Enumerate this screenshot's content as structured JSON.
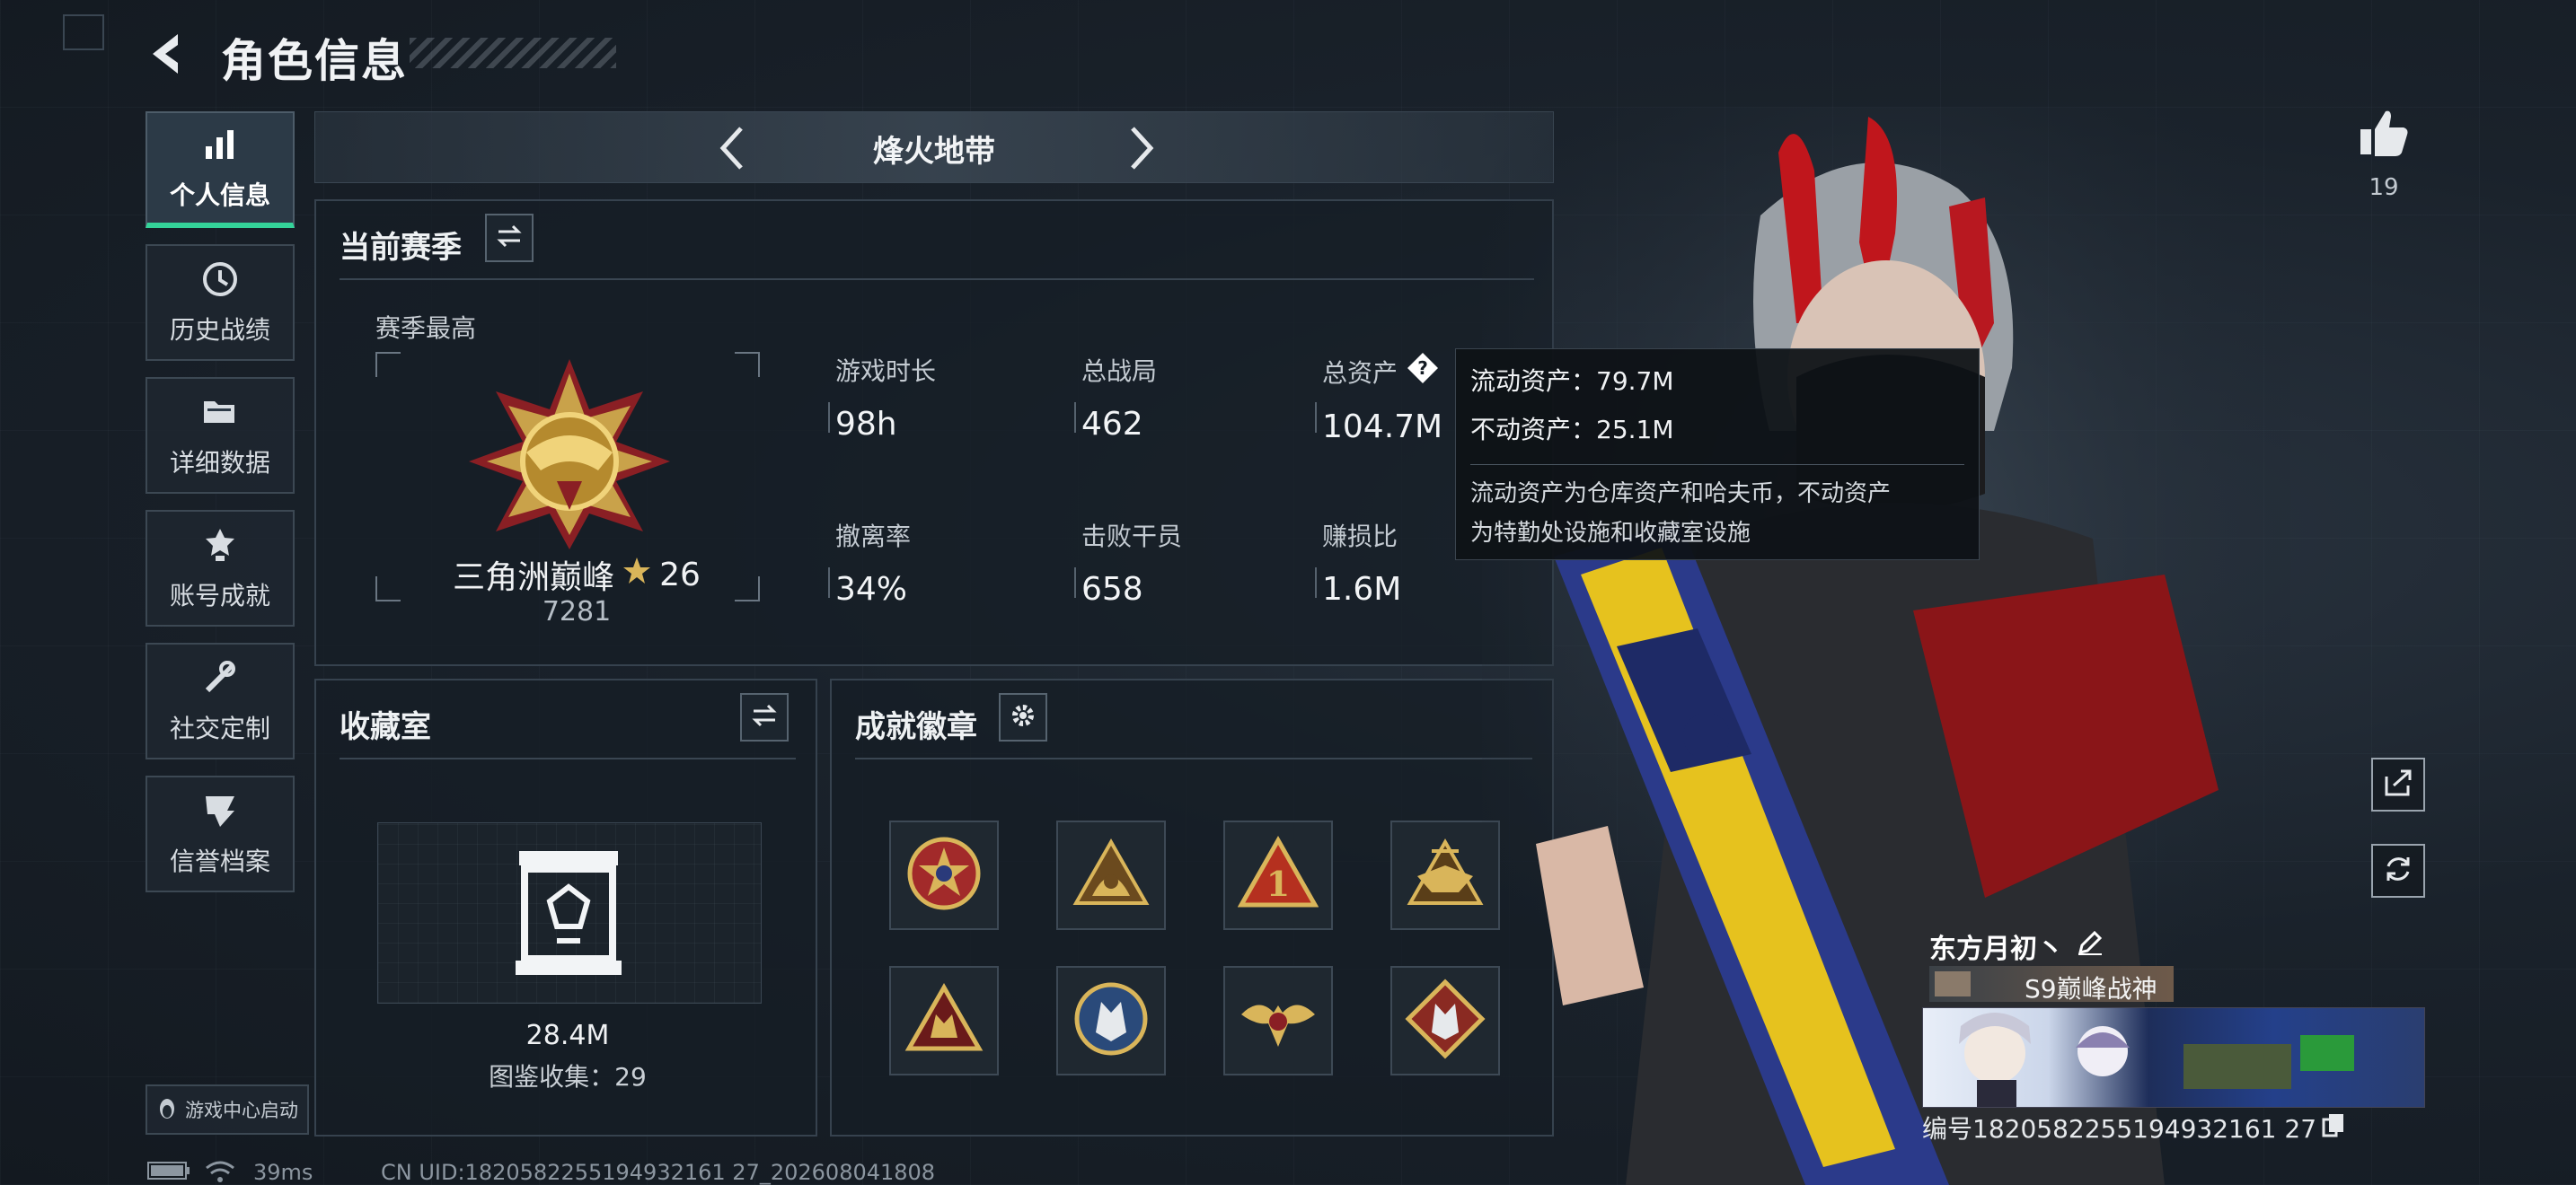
{
  "header": {
    "title": "角色信息"
  },
  "sidebar": {
    "items": [
      {
        "label": "个人信息",
        "icon": "bar-chart-icon",
        "active": true
      },
      {
        "label": "历史战绩",
        "icon": "history-icon",
        "active": false
      },
      {
        "label": "详细数据",
        "icon": "folder-icon",
        "active": false
      },
      {
        "label": "账号成就",
        "icon": "achievement-icon",
        "active": false
      },
      {
        "label": "社交定制",
        "icon": "tools-icon",
        "active": false
      },
      {
        "label": "信誉档案",
        "icon": "credit-icon",
        "active": false
      }
    ],
    "game_center_label": "游戏中心启动"
  },
  "mode_bar": {
    "title": "烽火地带"
  },
  "season": {
    "title": "当前赛季",
    "best_label": "赛季最高",
    "rank_name": "三角洲巅峰",
    "rank_stars": "26",
    "rank_score": "7281",
    "stats": [
      {
        "label": "游戏时长",
        "value": "98h"
      },
      {
        "label": "总战局",
        "value": "462"
      },
      {
        "label": "总资产",
        "value": "104.7M"
      },
      {
        "label": "撤离率",
        "value": "34%"
      },
      {
        "label": "击败干员",
        "value": "658"
      },
      {
        "label": "赚损比",
        "value": "1.6M"
      }
    ]
  },
  "tooltip": {
    "liquid": "流动资产：79.7M",
    "fixed": "不动资产：25.1M",
    "desc_line1": "流动资产为仓库资产和哈夫币，不动资产",
    "desc_line2": "为特勤处设施和收藏室设施"
  },
  "collection": {
    "title": "收藏室",
    "value": "28.4M",
    "codex": "图鉴收集：29"
  },
  "badges": {
    "title": "成就徽章",
    "items": [
      "star-medal-icon",
      "beast-badge-icon",
      "number-one-badge-icon",
      "eagle-triangle-badge-icon",
      "wolf-triangle-badge-icon",
      "wolf-circle-badge-icon",
      "winged-badge-icon",
      "wolf-diamond-badge-icon"
    ]
  },
  "footer": {
    "ping": "39ms",
    "uid": "CN UID:1820582255194932161 27_202608041808"
  },
  "player": {
    "like_count": "19",
    "name": "东方月初丶",
    "title": "S9巅峰战神",
    "id_line": "编号1820582255194932161 27"
  },
  "colors": {
    "accent_green": "#34d399",
    "panel_border": "#36424e",
    "background": "#151c24"
  }
}
